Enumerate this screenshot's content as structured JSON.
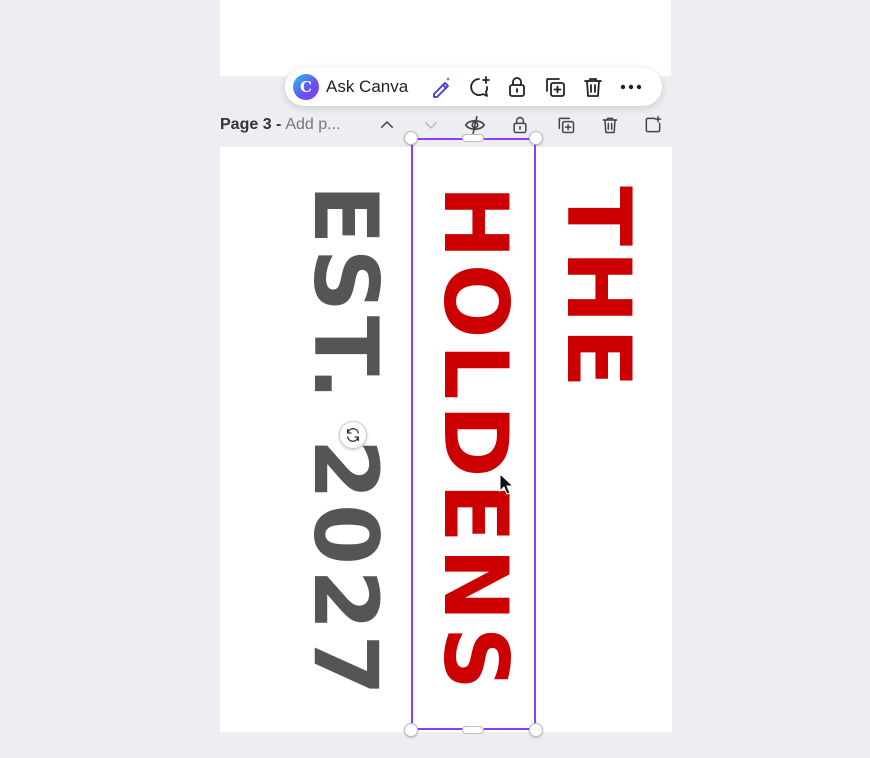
{
  "toolbar": {
    "ask_label": "Ask Canva",
    "logo_letter": "C",
    "buttons": [
      "magic-edit-icon",
      "comment-add-icon",
      "lock-icon",
      "duplicate-icon",
      "trash-icon",
      "more-icon"
    ]
  },
  "page_header": {
    "page_number": "Page 3 -",
    "title_placeholder": "Add p..."
  },
  "design": {
    "est_text": "EST. 2027",
    "the_text": "THE",
    "holdens_text": "HOLDENS"
  },
  "colors": {
    "brand_purple": "#8b3dff",
    "text_red": "#cc0000",
    "text_gray": "#555555"
  }
}
